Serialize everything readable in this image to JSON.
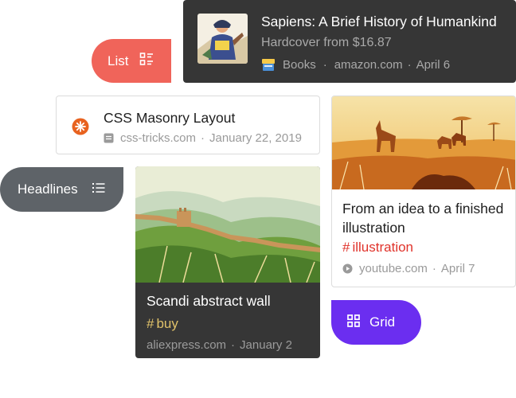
{
  "cards": {
    "sapiens": {
      "title": "Sapiens: A Brief History of Humankind",
      "subtitle": "Hardcover from $16.87",
      "collection": "Books",
      "domain": "amazon.com",
      "date": "April 6"
    },
    "css_masonry": {
      "title": "CSS Masonry Layout",
      "domain": "css-tricks.com",
      "date": "January 22, 2019"
    },
    "scandi": {
      "title": "Scandi abstract wall",
      "tag": "buy",
      "domain": "aliexpress.com",
      "date": "January 2"
    },
    "illustration": {
      "title": "From an idea to a finished illustration",
      "tag": "illustration",
      "domain": "youtube.com",
      "date": "April 7"
    }
  },
  "views": {
    "list": {
      "label": "List",
      "color": "#f0645a"
    },
    "headlines": {
      "label": "Headlines",
      "color": "#5e6368"
    },
    "grid": {
      "label": "Grid",
      "color": "#6b2ef0"
    }
  },
  "symbols": {
    "hash": "#",
    "dot": "·"
  },
  "colors": {
    "dark_card": "#363636",
    "tag_buy": "#e0c26a",
    "tag_illustration": "#e0332b"
  },
  "icons": [
    "book-cover-thumbnail",
    "books-collection-icon",
    "css-tricks-favicon",
    "article-icon",
    "youtube-play-icon",
    "list-view-icon",
    "headlines-view-icon",
    "grid-view-icon"
  ]
}
